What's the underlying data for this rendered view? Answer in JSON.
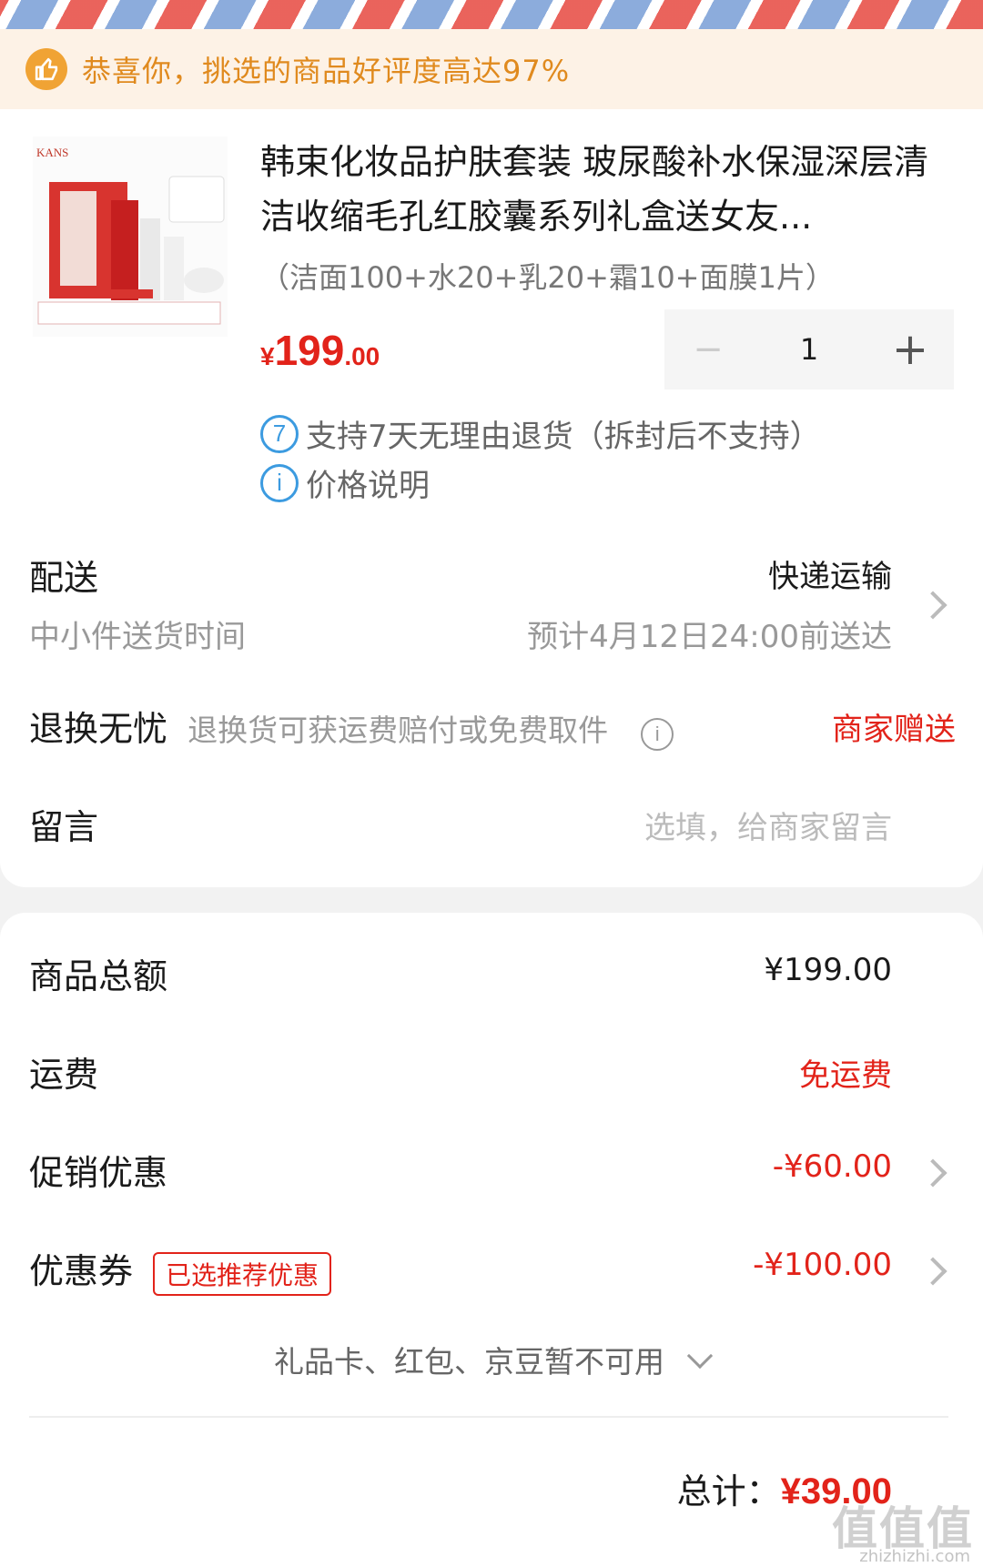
{
  "banner": {
    "icon": "thumbs-up-icon",
    "text": "恭喜你，挑选的商品好评度高达97%"
  },
  "product": {
    "brand": "KANS",
    "title": "韩束化妆品护肤套装 玻尿酸补水保湿深层清洁收缩毛孔红胶囊系列礼盒送女友...",
    "spec": "（洁面100+水20+乳20+霜10+面膜1片）",
    "price_currency": "¥",
    "price_int": "199",
    "price_dec": ".00",
    "quantity": "1",
    "minus": "−",
    "plus": "+"
  },
  "services": [
    {
      "icon_text": "7",
      "text": "支持7天无理由退货（拆封后不支持）"
    },
    {
      "icon_text": "i",
      "text": "价格说明"
    }
  ],
  "delivery": {
    "label": "配送",
    "method": "快递运输",
    "sub_label": "中小件送货时间",
    "eta": "预计4月12日24:00前送达"
  },
  "returns": {
    "label": "退换无忧",
    "desc": "退换货可获运费赔付或免费取件",
    "value": "商家赠送"
  },
  "message": {
    "label": "留言",
    "placeholder": "选填，给商家留言"
  },
  "summary": {
    "goods_total_label": "商品总额",
    "goods_total": "¥199.00",
    "shipping_label": "运费",
    "shipping": "免运费",
    "promo_label": "促销优惠",
    "promo": "-¥60.00",
    "coupon_label": "优惠券",
    "coupon_tag": "已选推荐优惠",
    "coupon": "-¥100.00",
    "unavailable": "礼品卡、红包、京豆暂不可用",
    "total_label": "总计：",
    "total": "¥39.00"
  },
  "watermark": {
    "text": "值值值",
    "sub": "zhizhizhi.com"
  },
  "colors": {
    "accent_red": "#e2231a",
    "banner_bg": "#fdf2e6",
    "banner_text": "#e08a1e",
    "info_blue": "#3c9be0"
  }
}
